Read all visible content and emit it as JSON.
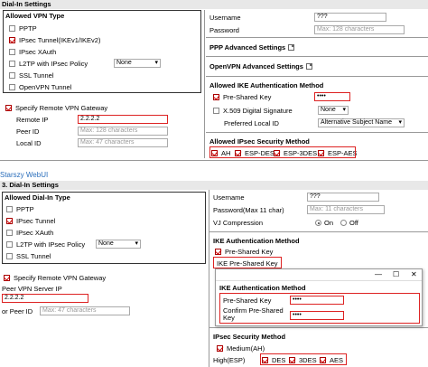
{
  "top": {
    "title": "Dial-In Settings",
    "allowed_vpn": {
      "title": "Allowed VPN Type",
      "items": [
        {
          "label": "PPTP",
          "checked": false
        },
        {
          "label": "IPsec Tunnel(IKEv1/IKEv2)",
          "checked": true
        },
        {
          "label": "IPsec XAuth",
          "checked": false
        },
        {
          "label": "L2TP with IPsec Policy",
          "checked": false
        },
        {
          "label": "SSL Tunnel",
          "checked": false
        },
        {
          "label": "OpenVPN Tunnel",
          "checked": false
        }
      ],
      "l2tp_policy": "None"
    },
    "remote": {
      "specify_label": "Specify Remote VPN Gateway",
      "remote_ip_label": "Remote IP",
      "remote_ip_value": "2.2.2.2",
      "peer_id_label": "Peer ID",
      "peer_id_placeholder": "Max: 128 characters",
      "local_id_label": "Local ID",
      "local_id_placeholder": "Max: 47 characters"
    },
    "right": {
      "username_label": "Username",
      "username_value": "???",
      "password_label": "Password",
      "password_placeholder": "Max: 128 characters",
      "ppp_adv": "PPP Advanced Settings",
      "openvpn_adv": "OpenVPN Advanced Settings",
      "ike_title": "Allowed IKE Authentication Method",
      "psk_label": "Pre-Shared Key",
      "psk_value": "••••",
      "x509_label": "X.509 Digital Signature",
      "x509_select": "None",
      "pref_local_label": "Preferred Local ID",
      "pref_local_select": "Alternative Subject Name",
      "ipsec_title": "Allowed IPsec Security Method",
      "ipsec_methods": [
        "AH",
        "ESP-DES",
        "ESP-3DES",
        "ESP-AES"
      ]
    }
  },
  "old_link": "Starszy WebUI",
  "bottom": {
    "title": "3. Dial-In Settings",
    "allowed_dial": {
      "title": "Allowed Dial-In Type",
      "items": [
        {
          "label": "PPTP",
          "checked": false
        },
        {
          "label": "IPsec Tunnel",
          "checked": true
        },
        {
          "label": "IPsec XAuth",
          "checked": false
        },
        {
          "label": "L2TP with IPsec Policy",
          "checked": false
        },
        {
          "label": "SSL Tunnel",
          "checked": false
        }
      ],
      "l2tp_policy": "None"
    },
    "remote": {
      "specify_label": "Specify Remote VPN Gateway",
      "peer_ip_label": "Peer VPN Server IP",
      "peer_ip_value": "2.2.2.2",
      "or_peer_label": "or Peer ID",
      "or_peer_placeholder": "Max: 47 characters"
    },
    "right": {
      "username_label": "Username",
      "username_value": "???",
      "password_label": "Password(Max 11 char)",
      "password_placeholder": "Max: 11 characters",
      "vj_label": "VJ Compression",
      "vj_on": "On",
      "vj_off": "Off",
      "ike_title": "IKE Authentication Method",
      "psk_label": "Pre-Shared Key",
      "ike_psk_label": "IKE Pre-Shared Key",
      "ipsec_title": "IPsec Security Method",
      "medium": "Medium(AH)",
      "high": "High(ESP)",
      "high_methods": [
        "DES",
        "3DES",
        "AES"
      ]
    },
    "popup": {
      "title": "IKE Authentication Method",
      "psk_label": "Pre-Shared Key",
      "psk_value": "••••",
      "confirm_label": "Confirm Pre-Shared Key",
      "confirm_value": "••••",
      "minimize": "—",
      "maximize": "☐",
      "close": "✕"
    }
  }
}
